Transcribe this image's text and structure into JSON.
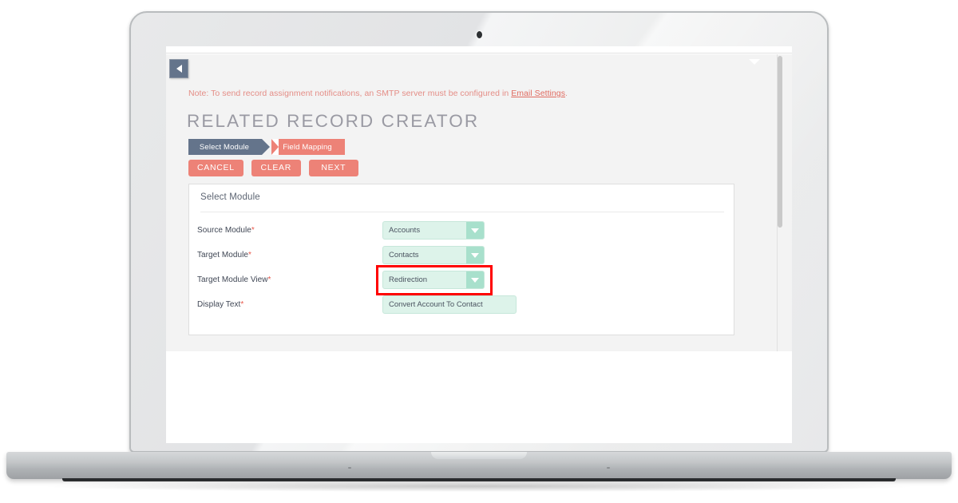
{
  "window": {
    "collapse_tab_icon": "triangle-left-icon",
    "top_caret_icon": "chevron-down-icon"
  },
  "note": {
    "prefix": "Note: To send record assignment notifications, an SMTP server must be configured in ",
    "link_label": "Email Settings",
    "suffix": "."
  },
  "page": {
    "title": "RELATED RECORD CREATOR"
  },
  "steps": [
    {
      "label": "Select Module",
      "state": "active",
      "color": "#64748b"
    },
    {
      "label": "Field Mapping",
      "state": "upcoming",
      "color": "#ed8277"
    }
  ],
  "actions": [
    {
      "label": "CANCEL",
      "name": "cancel-button"
    },
    {
      "label": "CLEAR",
      "name": "clear-button"
    },
    {
      "label": "NEXT",
      "name": "next-button"
    }
  ],
  "card": {
    "heading": "Select Module",
    "fields": [
      {
        "label": "Source Module",
        "required": "*",
        "type": "select",
        "value": "Accounts",
        "highlighted": false
      },
      {
        "label": "Target Module",
        "required": "*",
        "type": "select",
        "value": "Contacts",
        "highlighted": false
      },
      {
        "label": "Target Module View",
        "required": "*",
        "type": "select",
        "value": "Redirection",
        "highlighted": true
      },
      {
        "label": "Display Text",
        "required": "*",
        "type": "text",
        "value": "Convert Account To Contact",
        "highlighted": false
      }
    ]
  },
  "colors": {
    "accent_salmon": "#ed8277",
    "step_active_gray": "#64748b",
    "field_mint_bg": "#ddf3ea",
    "field_mint_arrow": "#a8e0cc",
    "highlight_red": "#ff0000",
    "note_text": "#e48d86",
    "title_gray": "#9a9aa3"
  }
}
